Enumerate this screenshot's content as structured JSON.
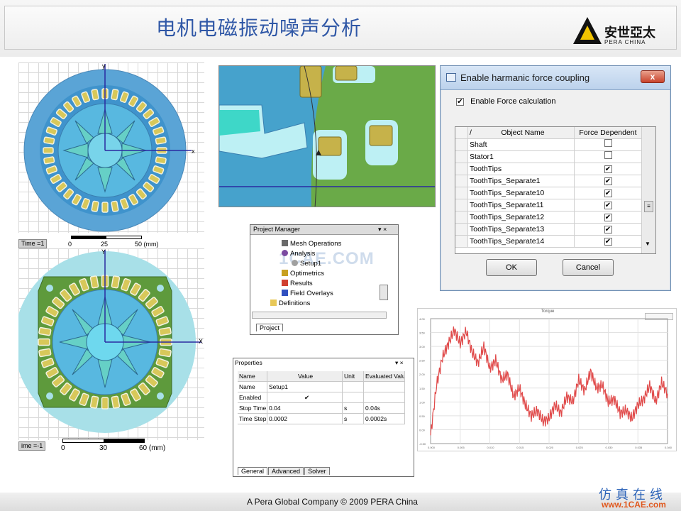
{
  "header": {
    "title": "电机电磁振动噪声分析",
    "logo_cn": "安世亞太",
    "logo_en": "PERA CHINA"
  },
  "plot_top": {
    "axis_y": "y",
    "axis_x": "x",
    "time_label": "Time =1",
    "scale_ticks": [
      "0",
      "25",
      "50 (mm)"
    ]
  },
  "plot_bottom": {
    "axis_y": "Y",
    "axis_x": "X",
    "time_label": "ime =-1",
    "scale_ticks": [
      "0",
      "30",
      "60 (mm)"
    ]
  },
  "dialog": {
    "title": "Enable harmanic force coupling",
    "close": "x",
    "enable_force_label": "Enable Force calculation",
    "enable_force_checked": "✔",
    "col_blank": "/",
    "col_name": "Object Name",
    "col_force": "Force Dependent",
    "rows": [
      {
        "name": "Shaft",
        "check": ""
      },
      {
        "name": "Stator1",
        "check": ""
      },
      {
        "name": "ToothTips",
        "check": "✔"
      },
      {
        "name": "ToothTips_Separate1",
        "check": "✔"
      },
      {
        "name": "ToothTips_Separate10",
        "check": "✔"
      },
      {
        "name": "ToothTips_Separate11",
        "check": "✔"
      },
      {
        "name": "ToothTips_Separate12",
        "check": "✔"
      },
      {
        "name": "ToothTips_Separate13",
        "check": "✔"
      },
      {
        "name": "ToothTips_Separate14",
        "check": "✔"
      }
    ],
    "ok": "OK",
    "cancel": "Cancel"
  },
  "project_manager": {
    "title": "Project Manager",
    "controls": "▾ ×",
    "items": [
      "Mesh Operations",
      "Analysis",
      "Setup1",
      "Optimetrics",
      "Results",
      "Field Overlays",
      "Definitions"
    ],
    "tab": "Project",
    "watermark": "1CAE.COM"
  },
  "properties": {
    "title": "Properties",
    "controls": "▾ ×",
    "headers": [
      "Name",
      "Value",
      "Unit",
      "Evaluated Value"
    ],
    "rows": [
      {
        "name": "Name",
        "value": "Setup1",
        "unit": "",
        "eval": ""
      },
      {
        "name": "Enabled",
        "value": "✔",
        "unit": "",
        "eval": ""
      },
      {
        "name": "Stop Time",
        "value": "0.04",
        "unit": "s",
        "eval": "0.04s"
      },
      {
        "name": "Time Step",
        "value": "0.0002",
        "unit": "s",
        "eval": "0.0002s"
      }
    ],
    "tabs": [
      "General",
      "Advanced",
      "Solver"
    ]
  },
  "chart_data": {
    "type": "line",
    "title": "Torque",
    "x": [
      0.0,
      0.001,
      0.002,
      0.003,
      0.004,
      0.005,
      0.006,
      0.007,
      0.008,
      0.009,
      0.01,
      0.011,
      0.012,
      0.013,
      0.014,
      0.015,
      0.016,
      0.017,
      0.018,
      0.019,
      0.02,
      0.021,
      0.022,
      0.023,
      0.024,
      0.025,
      0.026,
      0.027,
      0.028,
      0.029,
      0.03,
      0.031,
      0.032,
      0.033,
      0.034,
      0.035,
      0.036,
      0.037,
      0.038,
      0.039,
      0.04
    ],
    "series": [
      {
        "values": [
          -0.2,
          1.6,
          2.6,
          3.1,
          3.6,
          3.1,
          3.55,
          2.8,
          2.4,
          3.0,
          2.2,
          2.5,
          1.8,
          2.0,
          1.2,
          1.5,
          0.9,
          0.5,
          0.7,
          0.3,
          0.4,
          0.9,
          0.6,
          1.2,
          1.0,
          1.8,
          1.4,
          2.1,
          1.5,
          1.6,
          1.0,
          1.1,
          0.6,
          0.7,
          0.4,
          0.9,
          1.1,
          1.6,
          1.0,
          1.7,
          1.3
        ]
      }
    ],
    "series_color": "#e04a4a",
    "xlim": [
      0,
      0.04
    ],
    "ylim": [
      -0.5,
      4.0
    ],
    "grid": true
  },
  "footer": {
    "text": "A Pera Global Company © 2009 PERA China",
    "wm_cn": "仿真在线",
    "wm_en": "www.1CAE.com"
  }
}
